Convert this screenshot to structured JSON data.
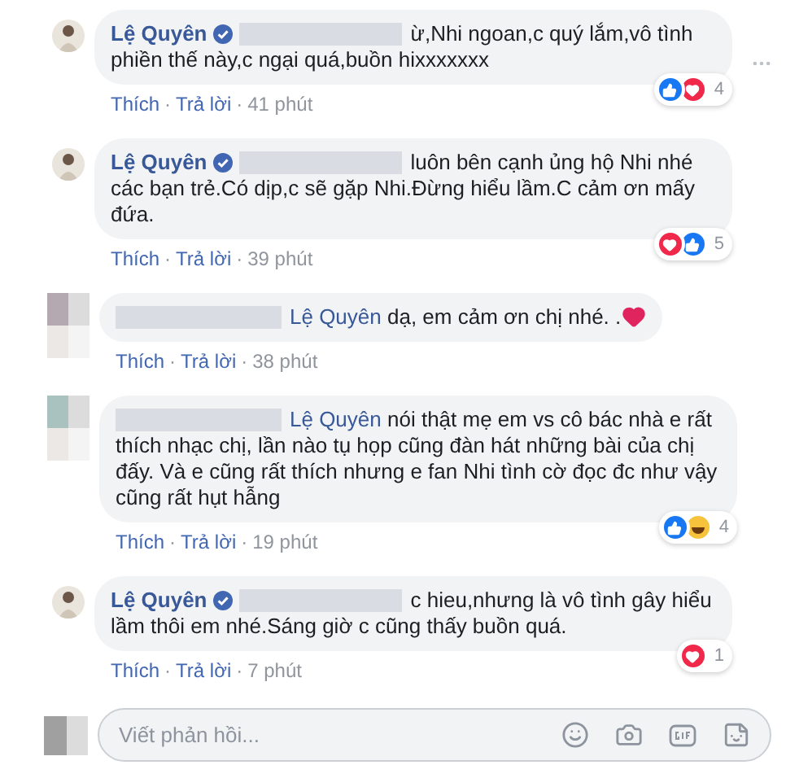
{
  "separator": "·",
  "comments": [
    {
      "avatar": {
        "kind": "photo"
      },
      "author": "Lệ Quyên",
      "verified": true,
      "redacted": true,
      "text": "ừ,Nhi ngoan,c quý lắm,vô tình phiền thế này,c ngại quá,buồn hixxxxxxx",
      "menu": true,
      "reactions": {
        "types": [
          {
            "kind": "like"
          },
          {
            "kind": "love"
          }
        ],
        "count": "4"
      },
      "actions": [
        "Thích",
        "Trả lời",
        "41 phút"
      ]
    },
    {
      "avatar": {
        "kind": "photo"
      },
      "author": "Lệ Quyên",
      "verified": true,
      "redacted": true,
      "text": "luôn bên cạnh ủng hộ Nhi nhé các bạn trẻ.Có dịp,c sẽ gặp Nhi.Đừng hiểu lầm.C cảm ơn mấy đứa.",
      "menu": false,
      "reactions": {
        "types": [
          {
            "kind": "love"
          },
          {
            "kind": "like"
          }
        ],
        "count": "5"
      },
      "actions": [
        "Thích",
        "Trả lời",
        "39 phút"
      ]
    },
    {
      "avatar": {
        "kind": "blurred",
        "color": "#b4a9b1"
      },
      "redacted": true,
      "mention": "Lệ Quyên",
      "text": "dạ, em cảm ơn chị nhé. .",
      "emoji": {
        "kind": "heart"
      },
      "menu": false,
      "actions": [
        "Thích",
        "Trả lời",
        "38 phút"
      ]
    },
    {
      "avatar": {
        "kind": "blurred",
        "color": "#a9c1bf"
      },
      "redacted": true,
      "mention": "Lệ Quyên",
      "text": "nói thật mẹ em vs cô bác nhà e rất thích nhạc chị, lần nào tụ họp cũng đàn hát những bài của chị đấy. Và e cũng rất thích nhưng e fan Nhi tình cờ đọc đc như vậy cũng rất hụt hẫng",
      "menu": false,
      "reactions": {
        "types": [
          {
            "kind": "like"
          },
          {
            "kind": "haha"
          }
        ],
        "count": "4"
      },
      "actions": [
        "Thích",
        "Trả lời",
        "19 phút"
      ]
    },
    {
      "avatar": {
        "kind": "photo"
      },
      "author": "Lệ Quyên",
      "verified": true,
      "redacted": true,
      "text": "c hieu,nhưng là vô tình gây hiểu lầm thôi em nhé.Sáng giờ c cũng thấy buồn quá.",
      "menu": false,
      "reactions": {
        "types": [
          {
            "kind": "love"
          }
        ],
        "count": "1"
      },
      "actions": [
        "Thích",
        "Trả lời",
        "7 phút"
      ]
    }
  ],
  "reply_field": {
    "placeholder": "Viết phản hồi..."
  }
}
